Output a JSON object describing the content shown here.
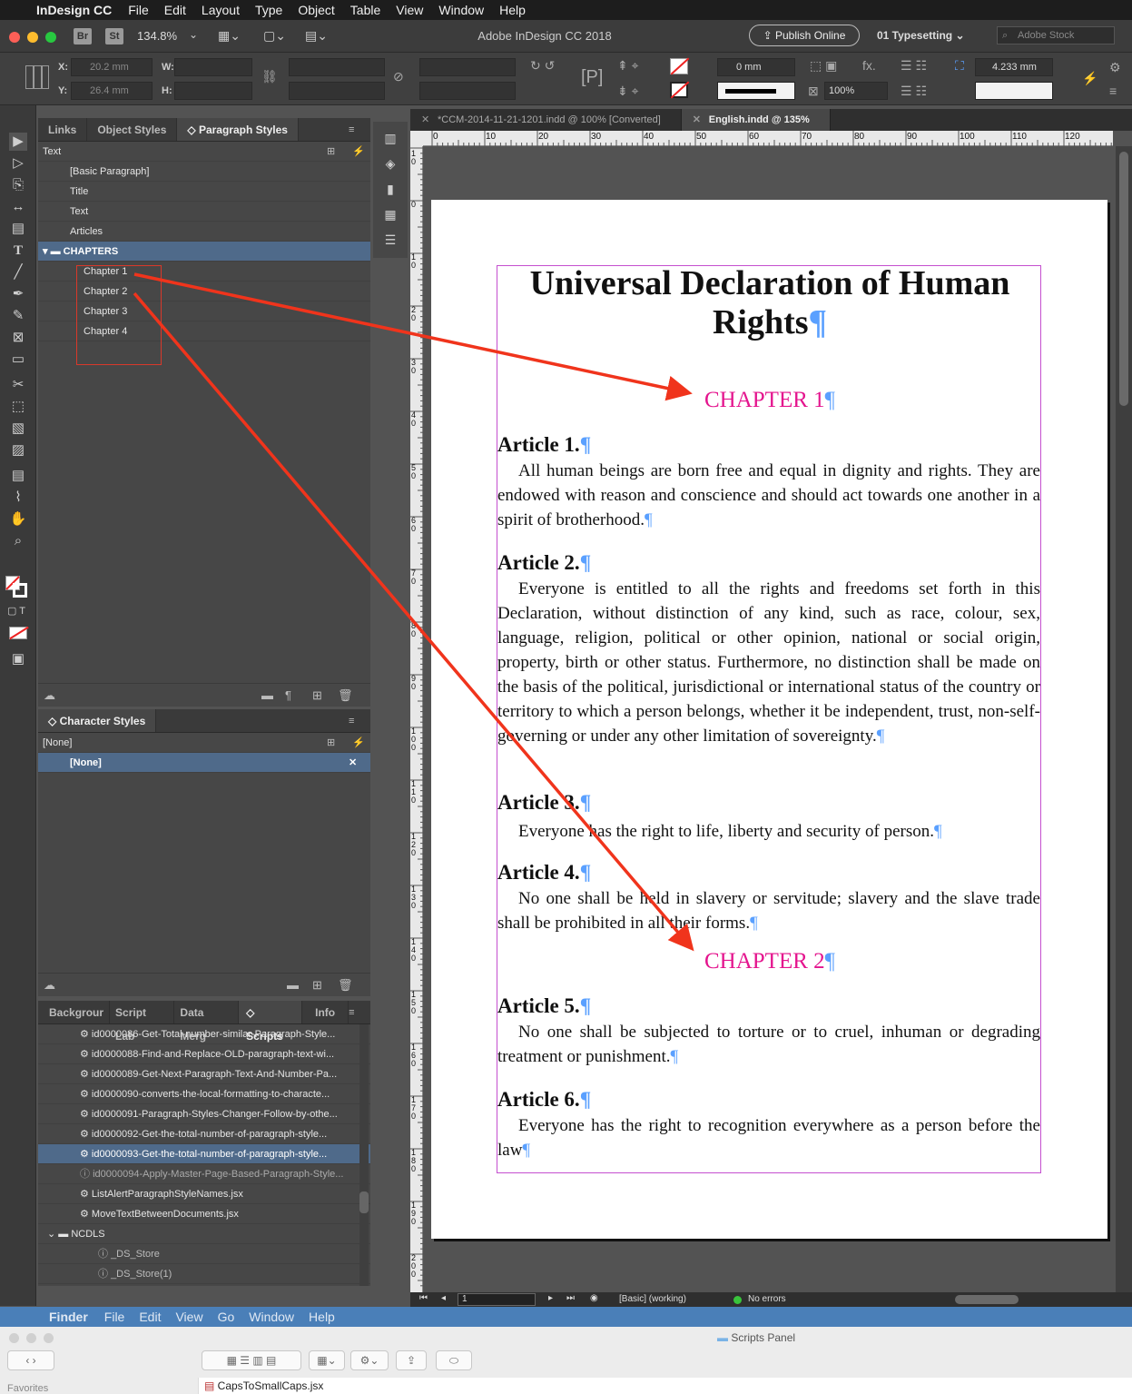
{
  "menubar": {
    "app": "InDesign CC",
    "items": [
      "File",
      "Edit",
      "Layout",
      "Type",
      "Object",
      "Table",
      "View",
      "Window",
      "Help"
    ]
  },
  "appbar": {
    "br": "Br",
    "st": "St",
    "zoom": "134.8%",
    "title": "Adobe InDesign CC 2018",
    "publish": "Publish Online",
    "workspace": "01 Typesetting",
    "stock_placeholder": "Adobe Stock"
  },
  "control": {
    "x_label": "X:",
    "y_label": "Y:",
    "w_label": "W:",
    "h_label": "H:",
    "x_value": "20.2 mm",
    "y_value": "26.4 mm",
    "stroke": "0 mm",
    "scale": "100%",
    "baseline": "4.233 mm"
  },
  "para_panel": {
    "tabs": [
      "Links",
      "Object Styles",
      "Paragraph Styles"
    ],
    "header": "Text",
    "items": [
      "[Basic Paragraph]",
      "Title",
      "Text",
      "Articles"
    ],
    "folder": "CHAPTERS",
    "children": [
      "Chapter 1",
      "Chapter 2",
      "Chapter 3",
      "Chapter 4"
    ]
  },
  "char_panel": {
    "tab": "Character Styles",
    "header": "[None]",
    "selected": "[None]"
  },
  "scripts_panel": {
    "tabs": [
      "Backgrour",
      "Script Lab",
      "Data Merg",
      "Scripts",
      "Info"
    ],
    "items": [
      "id0000086-Get-Total-number-similar-Paragraph-Style...",
      "id0000088-Find-and-Replace-OLD-paragraph-text-wi...",
      "id0000089-Get-Next-Paragraph-Text-And-Number-Pa...",
      "id0000090-converts-the-local-formatting-to-characte...",
      "id0000091-Paragraph-Styles-Changer-Follow-by-othe...",
      "id0000092-Get-the-total-number-of-paragraph-style...",
      "id0000093-Get-the-total-number-of-paragraph-style...",
      "id0000094-Apply-Master-Page-Based-Paragraph-Style...",
      "ListAlertParagraphStyleNames.jsx",
      "MoveTextBetweenDocuments.jsx"
    ],
    "folder": "NCDLS",
    "files": [
      "_DS_Store",
      "_DS_Store(1)"
    ]
  },
  "doctabs": [
    "*CCM-2014-11-21-1201.indd @ 100% [Converted]",
    "English.indd @ 135%"
  ],
  "ruler": {
    "h": [
      "0",
      "10",
      "20",
      "30",
      "40",
      "50",
      "60",
      "70",
      "80",
      "90",
      "100",
      "110",
      "120"
    ],
    "v": [
      "1 0",
      "0",
      "1 0",
      "2 0",
      "3 0",
      "4 0",
      "5 0",
      "6 0",
      "7 0",
      "8 0",
      "9 0",
      "1 0 0",
      "1 1 0",
      "1 2 0",
      "1 3 0",
      "1 4 0",
      "1 5 0",
      "1 6 0",
      "1 7 0",
      "1 8 0",
      "1 9 0",
      "2 0 0"
    ]
  },
  "document": {
    "title": "Universal Declaration of Human Rights",
    "chapter1": "CHAPTER 1",
    "chapter2": "CHAPTER 2",
    "articles": [
      {
        "heading": "Article 1.",
        "text": "All human beings are born free and equal in dignity and rights. They are endowed with reason and conscience and should act towards one another in a spirit of brotherhood."
      },
      {
        "heading": "Article 2.",
        "text": "Everyone is entitled to all the rights and freedoms set forth in this Declaration, without distinction of any kind, such as race, colour, sex, language, religion, political or other opinion, national or social origin, property, birth or other status. Furthermore, no distinction shall be made on the basis of the political, jurisdictional or international status of the country or territory to which a person belongs, whether it be independent, trust, non-self-governing or under any other limitation of sovereignty."
      },
      {
        "heading": "Article 3.",
        "text": "Everyone has the right to life, liberty and security of person."
      },
      {
        "heading": "Article 4.",
        "text": "No one shall be held in slavery or servitude; slavery and the slave trade shall be prohibited in all their forms."
      },
      {
        "heading": "Article 5.",
        "text": "No one shall be subjected to torture or to cruel, inhuman or degrading treatment or punishment."
      },
      {
        "heading": "Article 6.",
        "text": "Everyone has the right to recognition everywhere as a person before the law"
      }
    ]
  },
  "statusbar": {
    "page": "1",
    "master": "[Basic] (working)",
    "errors": "No errors"
  },
  "finder": {
    "app": "Finder",
    "items": [
      "File",
      "Edit",
      "View",
      "Go",
      "Window",
      "Help"
    ],
    "window_title": "Scripts Panel",
    "sidebar_label": "Favorites",
    "file": "CapsToSmallCaps.jsx"
  },
  "colors": {
    "chapter": "#e4158e",
    "arrow": "#f0341c",
    "selection": "#4f6a8a",
    "frame": "#c44fcf"
  }
}
